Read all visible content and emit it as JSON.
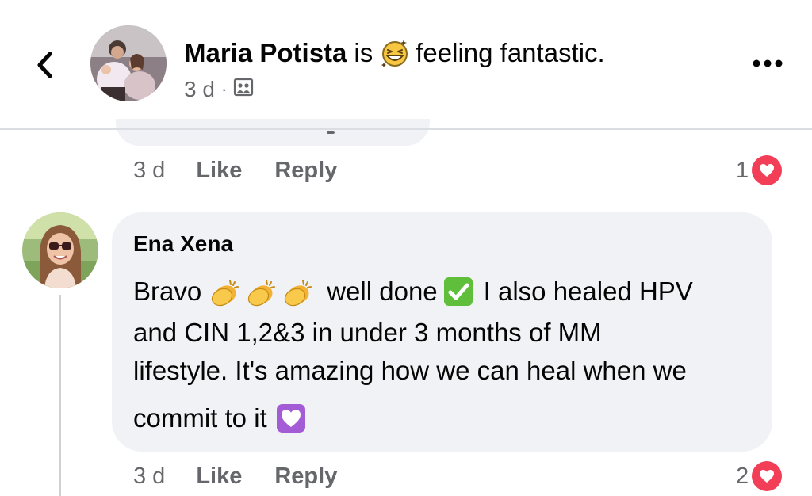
{
  "header": {
    "author_name": "Maria Potista",
    "is_text": "is",
    "feeling_text": "feeling fantastic.",
    "feeling_icon": "grinning-squinting-face-emoji",
    "time": "3 d",
    "separator": "·",
    "audience_icon": "photo-album-icon"
  },
  "previous_comment": {
    "time": "3 d",
    "like_label": "Like",
    "reply_label": "Reply",
    "reaction_count": "1",
    "reaction_icon": "heart-reaction-icon"
  },
  "comment": {
    "author": "Ena Xena",
    "segments": {
      "bravo": "Bravo",
      "well_done": "well done",
      "also_healed": "I also healed HPV",
      "line2": "and CIN 1,2&3 in under 3 months of MM",
      "line3": "lifestyle. It's amazing how we can heal when we",
      "line4": "commit to it"
    },
    "emojis": [
      "clapping-hands-emoji",
      "clapping-hands-emoji",
      "clapping-hands-emoji",
      "check-mark-button-emoji",
      "heart-decoration-emoji"
    ],
    "time": "3 d",
    "like_label": "Like",
    "reply_label": "Reply",
    "reaction_count": "2",
    "reaction_icon": "heart-reaction-icon"
  },
  "colors": {
    "bubble": "#f0f2f5",
    "secondary_text": "#65676b",
    "heart": "#f33e58",
    "check": "#5fbf3a",
    "heart_decoration": "#a35cd6"
  }
}
